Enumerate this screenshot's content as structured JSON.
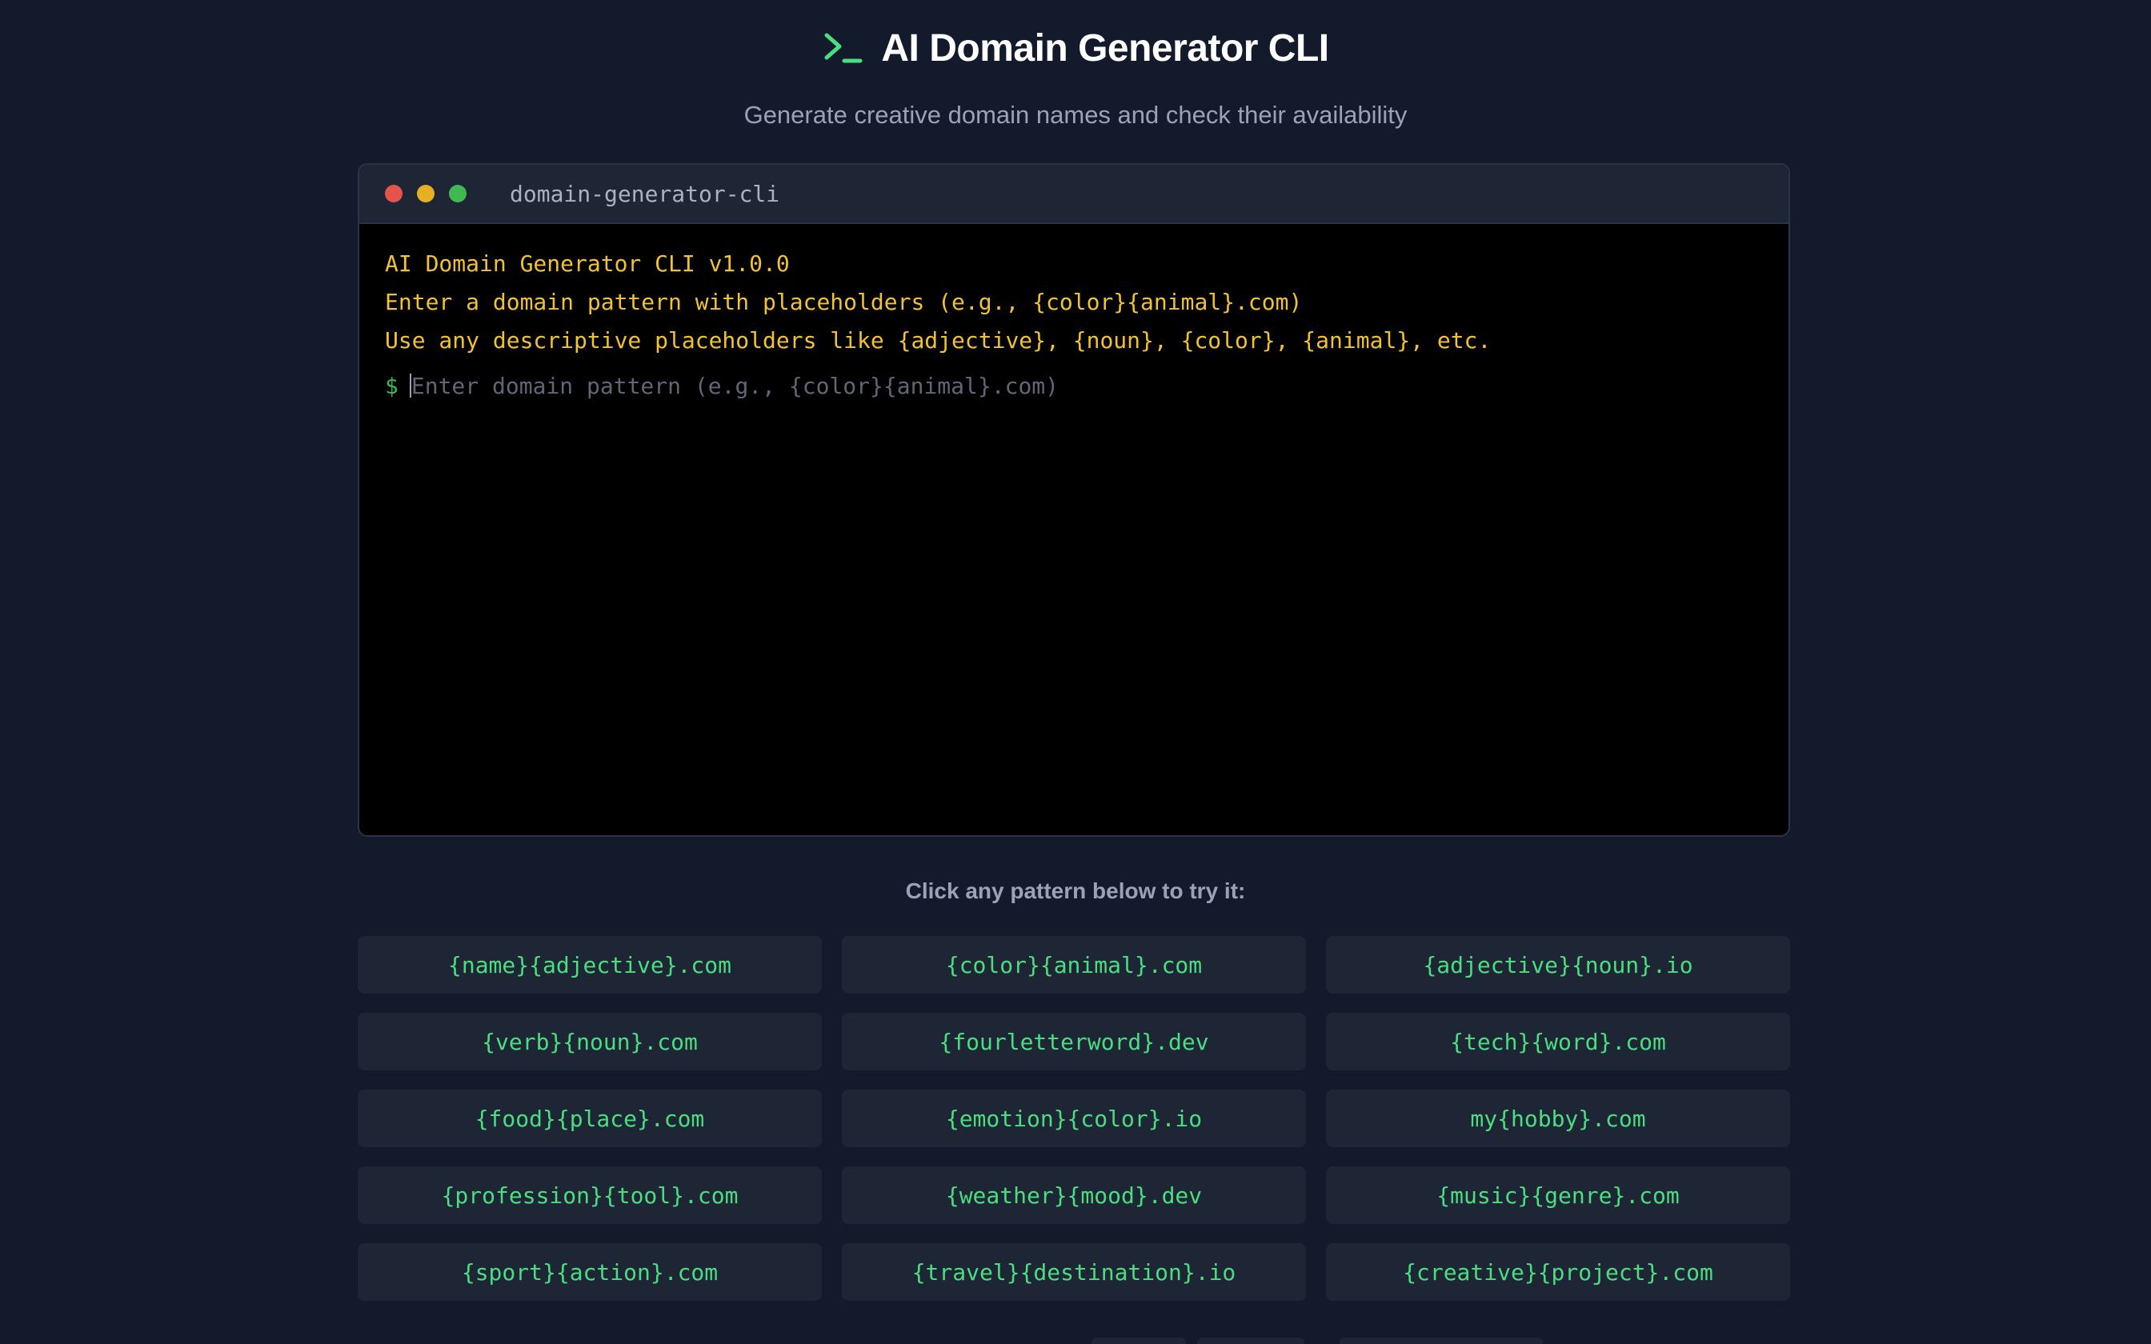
{
  "header": {
    "icon": "terminal-prompt-icon",
    "title": "AI Domain Generator CLI",
    "subtitle": "Generate creative domain names and check their availability"
  },
  "terminal": {
    "window_title": "domain-generator-cli",
    "lines": [
      "AI Domain Generator CLI v1.0.0",
      "Enter a domain pattern with placeholders (e.g., {color}{animal}.com)",
      "Use any descriptive placeholders like {adjective}, {noun}, {color}, {animal}, etc."
    ],
    "prompt_symbol": "$",
    "input_value": "",
    "input_placeholder": "Enter domain pattern (e.g., {color}{animal}.com)"
  },
  "patterns": {
    "hint": "Click any pattern below to try it:",
    "items": [
      "{name}{adjective}.com",
      "{color}{animal}.com",
      "{adjective}{noun}.io",
      "{verb}{noun}.com",
      "{fourletterword}.dev",
      "{tech}{word}.com",
      "{food}{place}.com",
      "{emotion}{color}.io",
      "my{hobby}.com",
      "{profession}{tool}.com",
      "{weather}{mood}.dev",
      "{music}{genre}.com",
      "{sport}{action}.com",
      "{travel}{destination}.io",
      "{creative}{project}.com"
    ]
  },
  "colors": {
    "background": "#131a2b",
    "accent_green": "#4ade80",
    "terminal_text": "#f1c232",
    "dot_red": "#e5534b",
    "dot_yellow": "#e6b022",
    "dot_green": "#3fb950"
  }
}
